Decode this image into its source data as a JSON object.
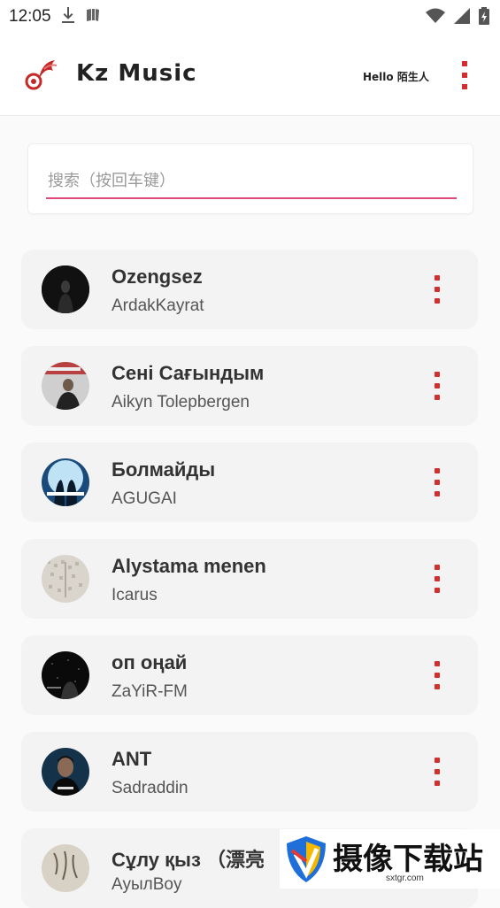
{
  "status_bar": {
    "time": "12:05",
    "left_icons": [
      "download-icon",
      "book-icon"
    ],
    "right_icons": [
      "wifi-icon",
      "signal-icon",
      "battery-icon"
    ]
  },
  "app_bar": {
    "title": "Kz Music",
    "greeting": "Hello 陌生人",
    "logo": "music-note-logo"
  },
  "search": {
    "placeholder": "搜索（按回车键）",
    "value": ""
  },
  "songs": [
    {
      "title": "Ozengsez",
      "artist": "ArdakKayrat"
    },
    {
      "title": "Сені Сағындым",
      "artist": "Aikyn Tolepbergen"
    },
    {
      "title": "Болмайды",
      "artist": "AGUGAI"
    },
    {
      "title": "Alystama menen",
      "artist": "Icarus"
    },
    {
      "title": "оп оңай",
      "artist": "ZaYiR-FM"
    },
    {
      "title": "ANT",
      "artist": "Sadraddin"
    },
    {
      "title": "Сұлу қыз （漂亮",
      "artist": "АуылBoy"
    }
  ],
  "watermark": {
    "text": "摄像下载站",
    "url": "sxtgr.com"
  },
  "colors": {
    "accent": "#d32f2f",
    "search_underline": "#e0487a",
    "card_bg": "#f3f3f3",
    "page_bg": "#fafafa"
  }
}
